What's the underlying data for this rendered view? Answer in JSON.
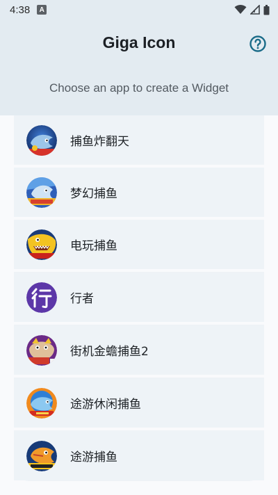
{
  "status_bar": {
    "time": "4:38",
    "notification_icon": "a-icon",
    "wifi_icon": "wifi-icon",
    "signal_icon": "signal-icon",
    "battery_icon": "battery-icon"
  },
  "header": {
    "title": "Giga Icon",
    "help_icon": "help-circle-icon",
    "subtitle": "Choose an app to create a Widget",
    "accent_color": "#1a6b88",
    "background_color": "#e3ebf1"
  },
  "apps": [
    {
      "label": "捕鱼炸翻天",
      "icon": "fishing-game-icon"
    },
    {
      "label": "梦幻捕鱼",
      "icon": "fishing-game-icon"
    },
    {
      "label": "电玩捕鱼",
      "icon": "fishing-game-icon"
    },
    {
      "label": "行者",
      "icon": "xingzhe-icon"
    },
    {
      "label": "街机金蟾捕鱼2",
      "icon": "fishing-game-icon"
    },
    {
      "label": "途游休闲捕鱼",
      "icon": "fishing-game-icon"
    },
    {
      "label": "途游捕鱼",
      "icon": "fishing-game-icon"
    }
  ]
}
